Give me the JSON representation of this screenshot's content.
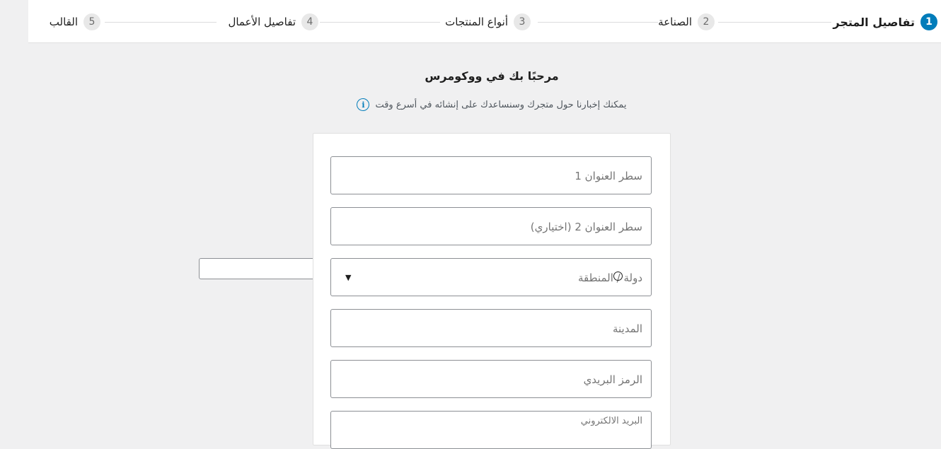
{
  "steps": [
    {
      "number": "1",
      "label": "تفاصيل المتجر",
      "active": true
    },
    {
      "number": "2",
      "label": "الصناعة",
      "active": false
    },
    {
      "number": "3",
      "label": "أنواع المنتجات",
      "active": false
    },
    {
      "number": "4",
      "label": "تفاصيل الأعمال",
      "active": false
    },
    {
      "number": "5",
      "label": "القالب",
      "active": false
    }
  ],
  "header": {
    "title": "مرحبًا بك في ووكومرس",
    "subtitle": "يمكنك إخبارنا حول متجرك وسنساعدك على إنشائه في أسرع وقت",
    "info_icon": "info-icon"
  },
  "form": {
    "address1_placeholder": "سطر العنوان 1",
    "address2_placeholder": "سطر العنوان 2 (اختياري)",
    "country_placeholder": "دولة / المنطقة",
    "city_placeholder": "المدينة",
    "postcode_placeholder": "الرمز البريدي",
    "email_placeholder": "البريد الالكتروني"
  },
  "colors": {
    "accent": "#007cba",
    "background": "#f0f0f1"
  }
}
